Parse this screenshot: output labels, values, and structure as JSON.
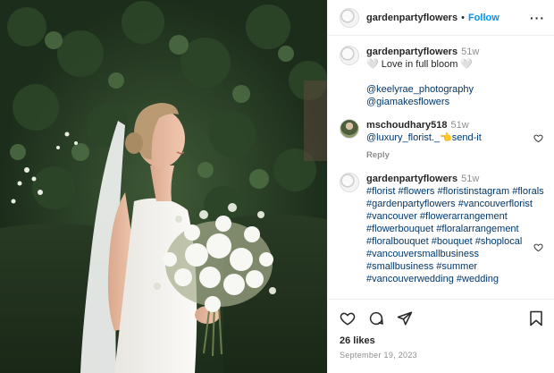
{
  "header": {
    "username": "gardenpartyflowers",
    "separator": "•",
    "follow_label": "Follow",
    "more_label": "···"
  },
  "caption": {
    "username": "gardenpartyflowers",
    "time": "51w",
    "text": "🤍 Love in full bloom 🤍",
    "mention1": "@keelyrae_photography",
    "mention2": "@giamakesflowers"
  },
  "comments": [
    {
      "username": "mschoudhary518",
      "time": "51w",
      "text": "@luxury_florist._👈send-it",
      "reply_label": "Reply"
    },
    {
      "username": "gardenpartyflowers",
      "time": "51w",
      "text": "#florist #flowers #floristinstagram #florals #gardenpartyflowers #vancouverflorist #vancouver #flowerarrangement #flowerbouquet #floralarrangement #floralbouquet #bouquet #shoplocal #vancouversmallbusiness #smallbusiness #summer #vancouverwedding #wedding"
    }
  ],
  "footer": {
    "likes": "26 likes",
    "date": "September 19, 2023"
  },
  "icons": {
    "like": "heart-icon",
    "comment": "comment-icon",
    "share": "share-icon",
    "save": "bookmark-icon"
  },
  "colors": {
    "accent": "#0095f6",
    "link": "#00376b",
    "muted": "#8e8e8e"
  }
}
